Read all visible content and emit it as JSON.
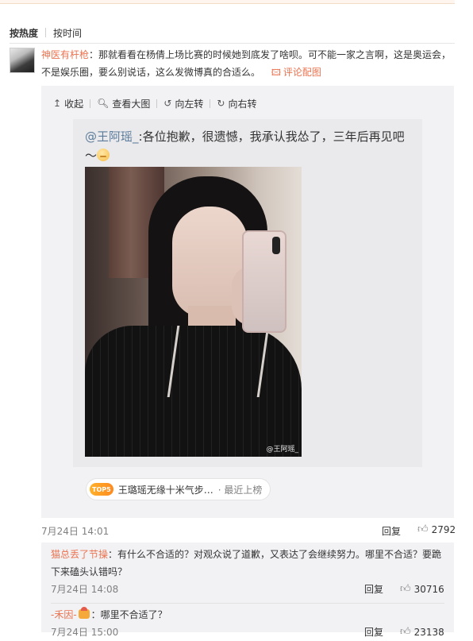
{
  "sort_bar": {
    "by_hot": "按热度",
    "by_time": "按时间"
  },
  "comment": {
    "user": "神医有杆枪",
    "separator": "：",
    "text": "那就看看在杨倩上场比赛的时候她到底发了啥呗。可不能一家之言啊，这是奥运会，不是娱乐圈，要么别说话，这么发微博真的合适么。",
    "pic_icon": "image-icon",
    "pic_link": "评论配图",
    "date": "7月24日 14:01",
    "reply": "回复",
    "likes": "2792"
  },
  "media_toolbar": {
    "collapse": "收起",
    "view_large": "查看大图",
    "rotate_left": "向左转",
    "rotate_right": "向右转"
  },
  "repost": {
    "at_user": "@王阿瑶_",
    "text": ":各位抱歉，很遗憾，我承认我怂了，三年后再见吧～",
    "emoji": "pensive-face-emoji",
    "photo_watermark": "@王阿瑶_"
  },
  "hot_tag": {
    "badge": "TOP5",
    "title": "王璐瑶无缘十米气步…",
    "sub": "· 最近上榜"
  },
  "subcomments": [
    {
      "user": "猫总丢了节操",
      "text": "：有什么不合适的？对观众说了道歉，又表达了会继续努力。哪里不合适？要跪下来磕头认错吗？",
      "date": "7月24日 14:08",
      "reply": "回复",
      "likes": "30716"
    },
    {
      "user": "-禾因-",
      "text": "：哪里不合适了？",
      "date": "7月24日 15:00",
      "reply": "回复",
      "likes": "23138"
    }
  ],
  "colors": {
    "link": "#eb7350",
    "at_link": "#5d7c9b",
    "panel_bg": "#f2f2f5"
  }
}
